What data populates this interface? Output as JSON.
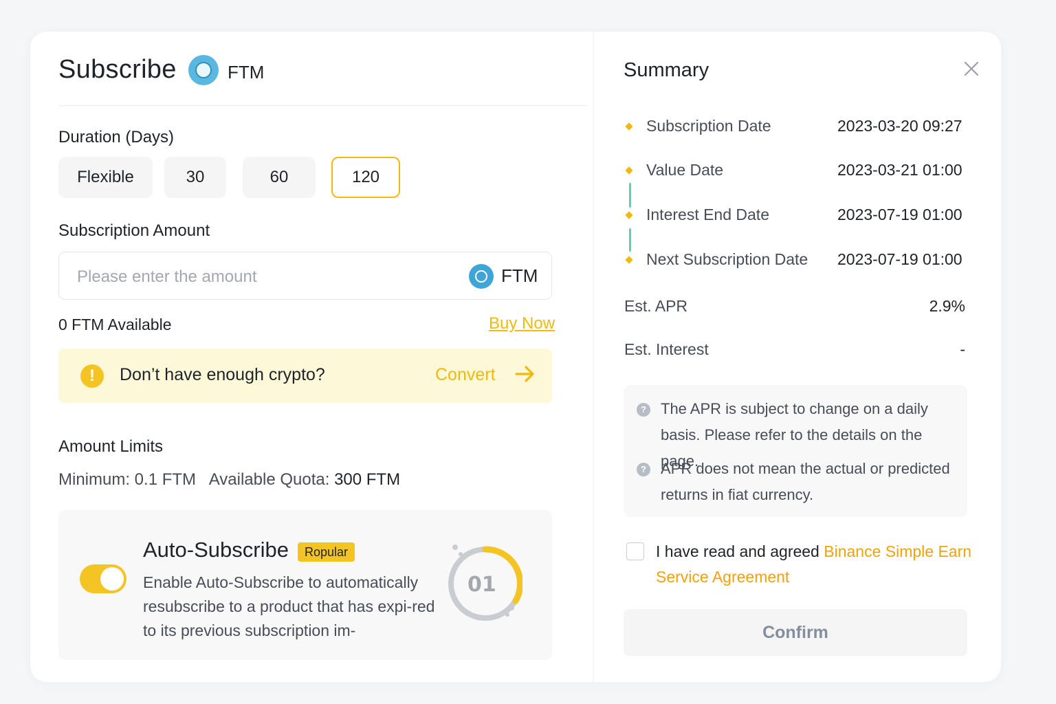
{
  "header": {
    "title": "Subscribe",
    "coin": "FTM"
  },
  "duration": {
    "label": "Duration (Days)",
    "options": [
      "Flexible",
      "30",
      "60",
      "120"
    ],
    "selected": "120"
  },
  "amount": {
    "label": "Subscription Amount",
    "placeholder": "Please enter the amount",
    "unit": "FTM",
    "available": "0 FTM Available",
    "buy_now": "Buy Now"
  },
  "alert": {
    "text": "Don’t have enough crypto?",
    "action": "Convert"
  },
  "limits": {
    "label": "Amount Limits",
    "minimum": "Minimum: 0.1 FTM",
    "quota_label": "Available Quota:",
    "quota_value": "300 FTM"
  },
  "auto_subscribe": {
    "title": "Auto-Subscribe",
    "badge": "Ropular",
    "description": "Enable Auto-Subscribe to automatically resubscribe to a product that has expi-red to its previous subscription im-",
    "enabled": true,
    "graphic_text": "01"
  },
  "summary": {
    "title": "Summary",
    "timeline": [
      {
        "label": "Subscription Date",
        "value": "2023-03-20 09:27"
      },
      {
        "label": "Value Date",
        "value": "2023-03-21 01:00"
      },
      {
        "label": "Interest End Date",
        "value": "2023-07-19 01:00"
      },
      {
        "label": "Next Subscription Date",
        "value": "2023-07-19 01:00"
      }
    ],
    "apr_label": "Est. APR",
    "apr_value": "2.9%",
    "interest_label": "Est. Interest",
    "interest_value": "-",
    "notes": [
      "The APR is subject to change on a daily basis. Please refer to the details on the page.",
      "APR does not mean the actual or predicted returns in fiat currency."
    ],
    "agree_text": "I have read and agreed ",
    "agree_link": "Binance Simple Earn Service Agreement",
    "confirm": "Confirm"
  },
  "colors": {
    "accent": "#f0b90b",
    "timeline_line": "#58d4b4",
    "alert_bg": "#fdf8d8"
  }
}
